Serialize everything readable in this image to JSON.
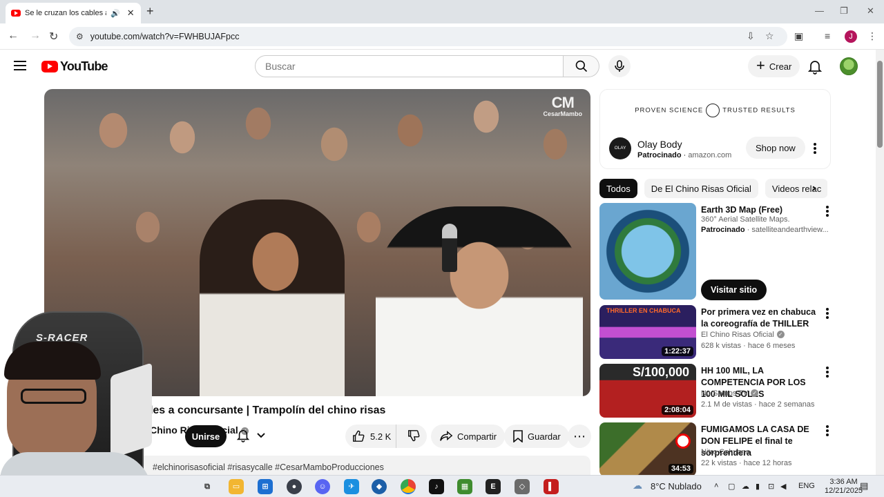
{
  "browser": {
    "tab_title": "Se le cruzan los cables a co",
    "url": "youtube.com/watch?v=FWHBUJAFpcc",
    "profile_initial": "J"
  },
  "header": {
    "logo_text": "YouTube",
    "search_placeholder": "Buscar",
    "create_label": "Crear"
  },
  "video": {
    "watermark_line1": "CM",
    "watermark_line2": "CesarMambo",
    "title": "Se le cruzan los cables a concursante | Trampolín del chino risas",
    "channel": "El Chino Risas Oficial",
    "join_label": "Unirse",
    "likes": "5.2 K",
    "share_label": "Compartir",
    "save_label": "Guardar",
    "hashtags": "#elchinorisasoficial #risasycalle #CesarMamboProducciones"
  },
  "webcam": {
    "chair_brand": "S-RACER"
  },
  "ad": {
    "banner_left": "PROVEN SCIENCE",
    "banner_right": "TRUSTED RESULTS",
    "logo_text": "OLAY",
    "name": "Olay Body",
    "sponsored": "Patrocinado",
    "domain": "amazon.com",
    "cta": "Shop now"
  },
  "chips": [
    "Todos",
    "De El Chino Risas Oficial",
    "Videos relac"
  ],
  "sponsored_card": {
    "title": "Earth 3D Map (Free)",
    "subtitle": "360° Aerial Satellite Maps.",
    "sponsored": "Patrocinado",
    "domain": "satelliteandearthview...",
    "cta": "Visitar sitio"
  },
  "recommendations": [
    {
      "title": "Por primera vez en chabuca la coreografía de THILLER",
      "channel": "El Chino Risas Oficial",
      "meta": "628 k vistas · hace 6 meses",
      "duration": "1:22:37",
      "thumb_text": "THRILLER EN CHABUCA"
    },
    {
      "title": "HH 100 MIL, LA COMPETENCIA POR LOS 100 MIL SOLES",
      "channel": "No Somos TV",
      "meta": "2.1 M de vistas · hace 2 semanas",
      "duration": "2:08:04",
      "thumb_text": "S/100,000"
    },
    {
      "title": "FUMIGAMOS LA CASA DE DON FELIPE el final te sorprendera",
      "channel": "Nitro Cahuana",
      "meta": "22 k vistas · hace 12 horas",
      "duration": "34:53",
      "thumb_text": ""
    }
  ],
  "taskbar": {
    "weather": "8°C Nublado",
    "language": "ENG",
    "time": "3:36 AM",
    "date": "12/21/2025"
  }
}
